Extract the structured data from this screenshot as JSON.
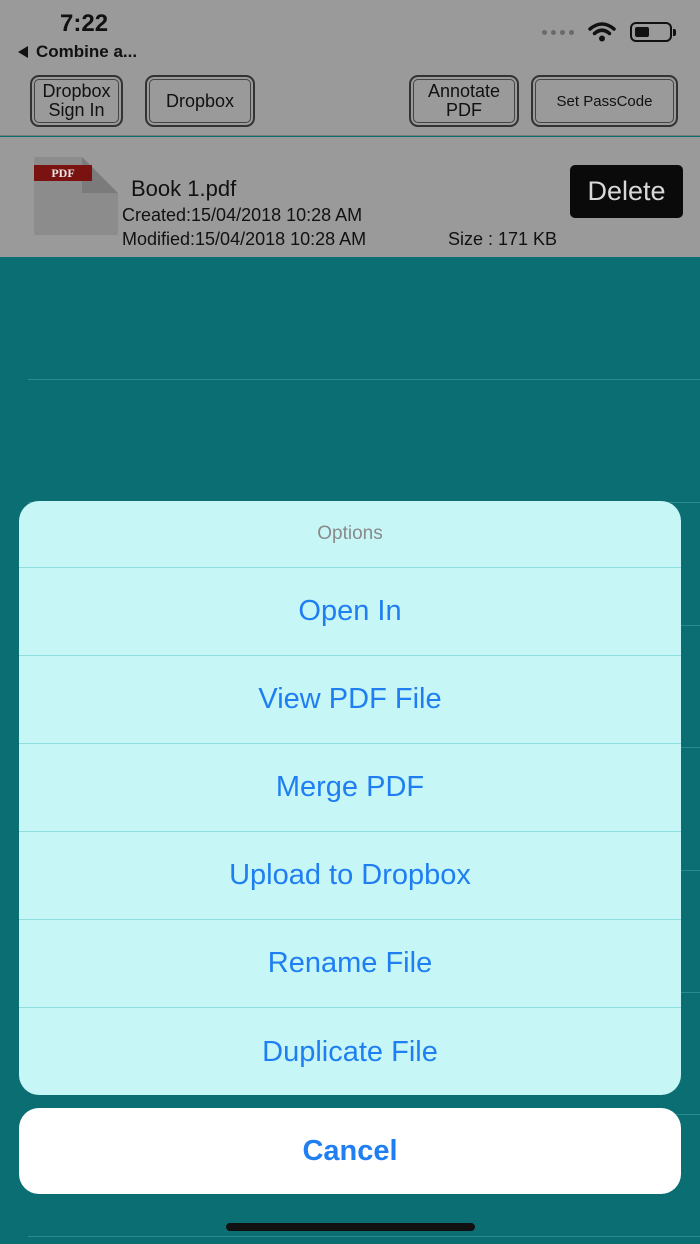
{
  "status_bar": {
    "time": "7:22",
    "back_label": "Combine a..."
  },
  "toolbar": {
    "dropbox_sign_in": [
      "Dropbox",
      "Sign In"
    ],
    "dropbox": "Dropbox",
    "annotate_pdf": [
      "Annotate",
      "PDF"
    ],
    "set_passcode": "Set PassCode"
  },
  "file": {
    "icon_label": "PDF",
    "name": "Book 1.pdf",
    "created": "Created:15/04/2018 10:28 AM",
    "modified": "Modified:15/04/2018 10:28 AM",
    "size": "Size : 171 KB",
    "delete_label": "Delete"
  },
  "action_sheet": {
    "title": "Options",
    "items": [
      "Open In",
      "View PDF File",
      "Merge PDF",
      "Upload to Dropbox",
      "Rename File",
      "Duplicate File"
    ],
    "cancel_label": "Cancel"
  },
  "colors": {
    "background_teal": "#0a6e73",
    "sheet_bg": "#c6f6f6",
    "action_blue": "#1f7ff2"
  }
}
